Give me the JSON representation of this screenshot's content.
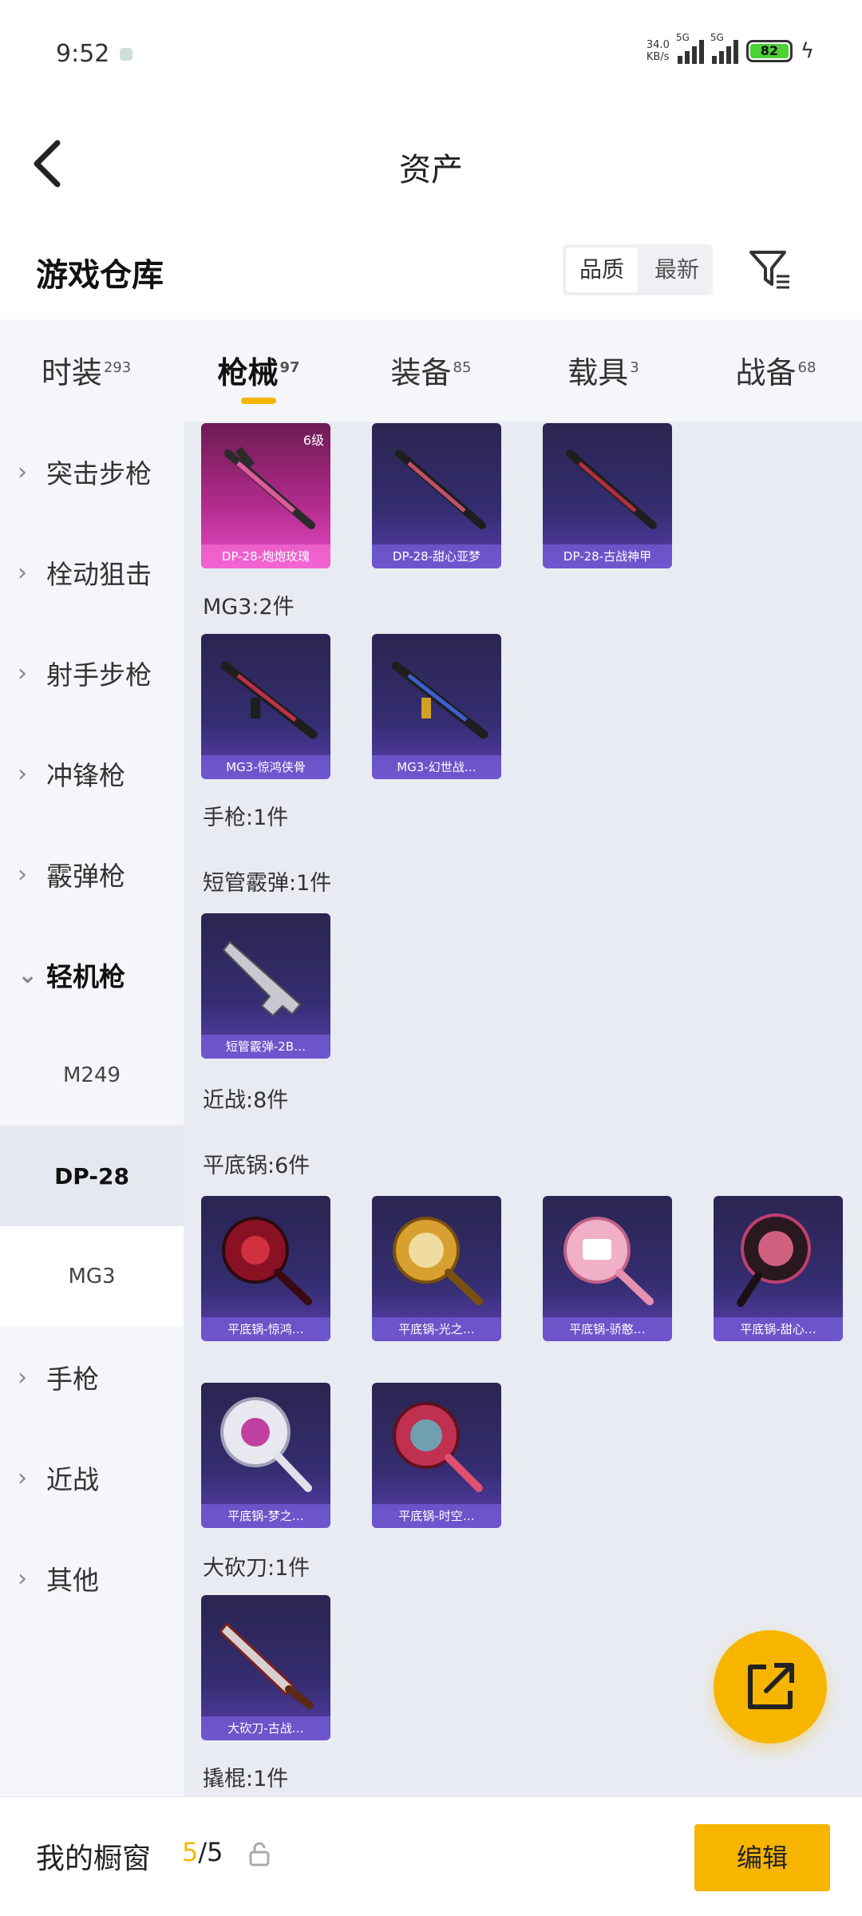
{
  "status_bar": {
    "time": "9:52",
    "net_speed_value": "34.0",
    "net_speed_unit": "KB/s",
    "signal1_label": "5G",
    "signal2_label": "5G",
    "battery": "82"
  },
  "nav": {
    "title": "资产"
  },
  "header": {
    "title": "游戏仓库",
    "sort_options": [
      "品质",
      "最新"
    ],
    "selected_sort": "品质"
  },
  "tabs": [
    {
      "label": "时装",
      "count": "293"
    },
    {
      "label": "枪械",
      "count": "97"
    },
    {
      "label": "装备",
      "count": "85"
    },
    {
      "label": "载具",
      "count": "3"
    },
    {
      "label": "战备",
      "count": "68"
    }
  ],
  "active_tab": "枪械",
  "sidebar": {
    "items": [
      {
        "label": "突击步枪"
      },
      {
        "label": "栓动狙击"
      },
      {
        "label": "射手步枪"
      },
      {
        "label": "冲锋枪"
      },
      {
        "label": "霰弹枪"
      },
      {
        "label": "轻机枪"
      }
    ],
    "subitems": [
      "M249",
      "DP-28",
      "MG3"
    ],
    "active_subitem": "DP-28",
    "items_after": [
      {
        "label": "手枪"
      },
      {
        "label": "近战"
      },
      {
        "label": "其他"
      }
    ]
  },
  "content": {
    "dp28_cards": [
      {
        "caption": "DP-28-炮炮玫瑰",
        "level": "6级",
        "style": "pink"
      },
      {
        "caption": "DP-28-甜心亚梦",
        "style": "purple"
      },
      {
        "caption": "DP-28-古战神甲",
        "style": "purple"
      }
    ],
    "mg3_label": "MG3:2件",
    "mg3_cards": [
      {
        "caption": "MG3-惊鸿侠骨",
        "style": "purple"
      },
      {
        "caption": "MG3-幻世战…",
        "style": "purple"
      }
    ],
    "pistol_label": "手枪:1件",
    "shotgun_label": "短管霰弹:1件",
    "shotgun_cards": [
      {
        "caption": "短管霰弹-2B…",
        "style": "purple"
      }
    ],
    "melee_label": "近战:8件",
    "pan_label": "平底锅:6件",
    "pan_cards": [
      {
        "caption": "平底锅-惊鸿…",
        "style": "purple"
      },
      {
        "caption": "平底锅-光之…",
        "style": "purple"
      },
      {
        "caption": "平底锅-骄憨…",
        "style": "purple"
      },
      {
        "caption": "平底锅-甜心…",
        "style": "purple"
      },
      {
        "caption": "平底锅-梦之…",
        "style": "purple"
      },
      {
        "caption": "平底锅-时空…",
        "style": "purple"
      }
    ],
    "machete_label": "大砍刀:1件",
    "machete_cards": [
      {
        "caption": "大砍刀-古战…",
        "style": "purple"
      }
    ],
    "crowbar_label": "撬棍:1件"
  },
  "bottom_bar": {
    "title": "我的橱窗",
    "current": "5",
    "separator": "/",
    "total": "5",
    "edit_label": "编辑"
  },
  "colors": {
    "accent": "#f7b500",
    "card_purple": "#342d70",
    "card_pink": "#b02a8a"
  }
}
